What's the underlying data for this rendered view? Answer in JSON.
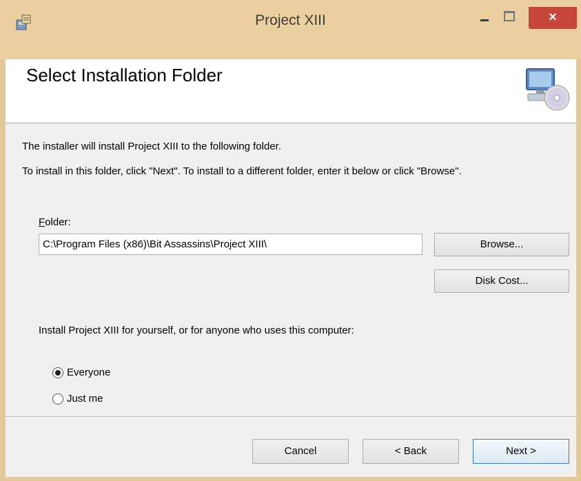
{
  "window": {
    "title": "Project XIII",
    "close_glyph": "×"
  },
  "banner": {
    "title": "Select Installation Folder",
    "icon": "computer-disc-icon"
  },
  "body": {
    "line1": "The installer will install Project XIII to the following folder.",
    "line2": "To install in this folder, click \"Next\". To install to a different folder, enter it below or click \"Browse\"."
  },
  "folder": {
    "label_access_key": "F",
    "label_rest": "older:",
    "value": "C:\\Program Files (x86)\\Bit Assassins\\Project XIII\\"
  },
  "buttons": {
    "browse": "Browse...",
    "disk_cost": "Disk Cost...",
    "cancel": "Cancel",
    "back": "< Back",
    "next": "Next >"
  },
  "install_for": {
    "prompt": "Install Project XIII for yourself, or for anyone who uses this computer:",
    "options": [
      {
        "label": "Everyone",
        "selected": true
      },
      {
        "label": "Just me",
        "selected": false
      }
    ]
  },
  "colors": {
    "titlebar": "#eccf9f",
    "close": "#c7463c",
    "dialog_bg": "#f0f0f0"
  }
}
